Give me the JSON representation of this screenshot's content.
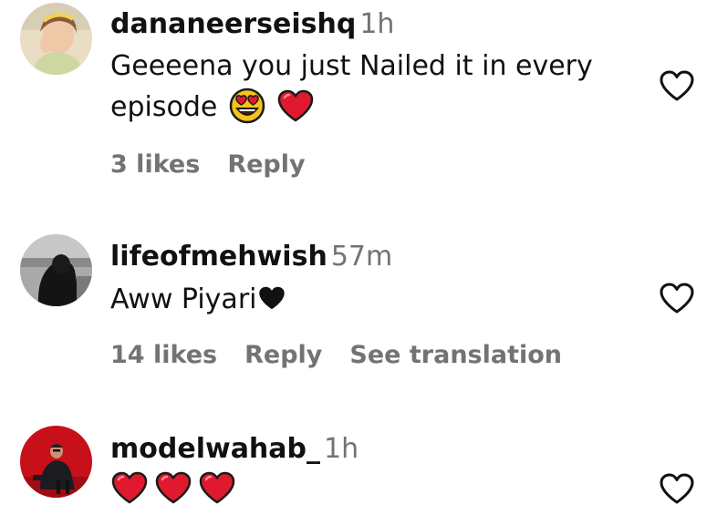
{
  "comments": [
    {
      "username": "dananeerseishq",
      "time": "1h",
      "text_line1": "Geeeena you just Nailed it in every",
      "text_line2": "episode",
      "emojis": [
        "heart-eyes-icon",
        "red-heart-icon"
      ],
      "likes": "3 likes",
      "reply": "Reply",
      "translate": ""
    },
    {
      "username": "lifeofmehwish",
      "time": "57m",
      "text_line1": "Aww Piyari",
      "emojis": [
        "black-heart-icon"
      ],
      "likes": "14 likes",
      "reply": "Reply",
      "translate": "See translation"
    },
    {
      "username": "modelwahab_",
      "time": "1h",
      "text_line1": "",
      "emojis": [
        "red-heart-icon",
        "red-heart-icon",
        "red-heart-icon"
      ]
    }
  ],
  "colors": {
    "text": "#111111",
    "muted": "#737373",
    "heart_red": "#e0192f",
    "like_outline": "#111111"
  }
}
